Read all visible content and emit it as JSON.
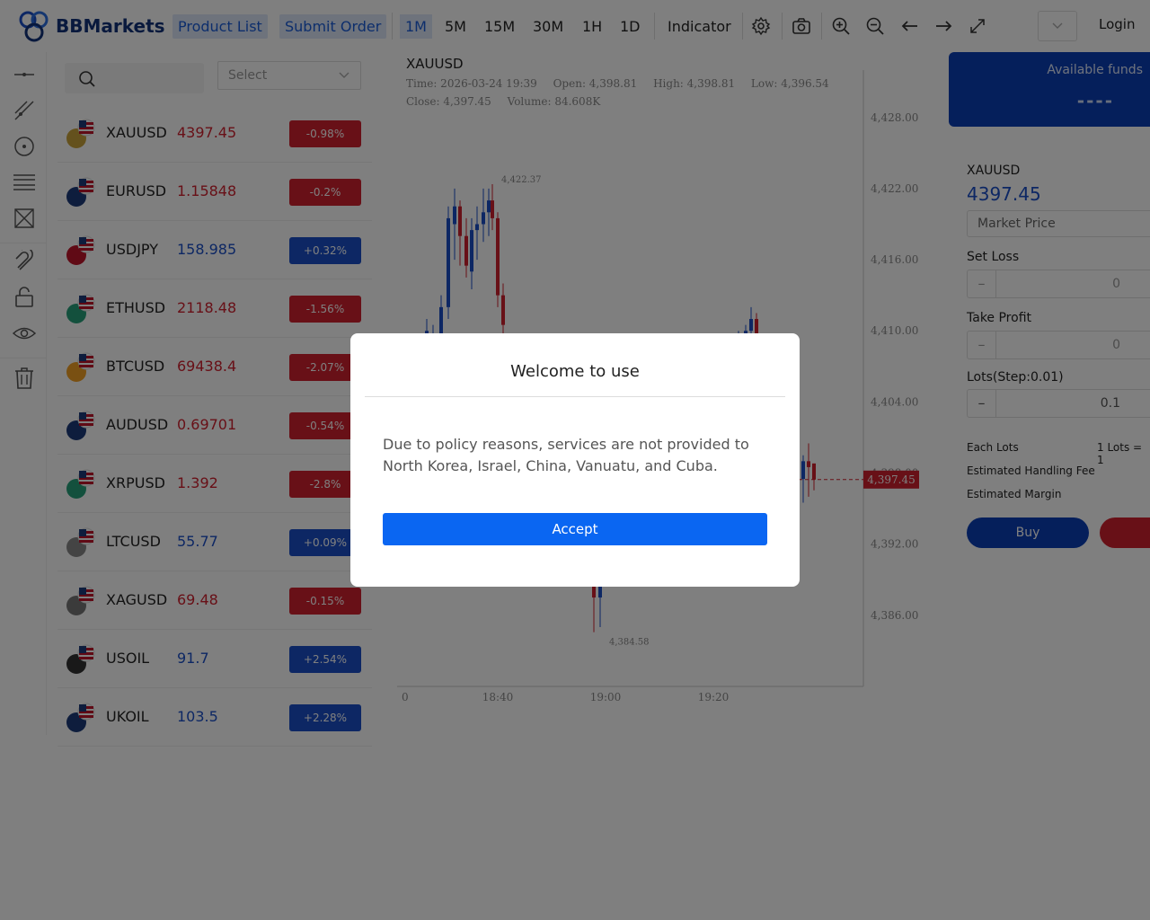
{
  "brand": {
    "name": "BBMarkets",
    "primary": "#0a3eb7",
    "accent": "#1a5dd9"
  },
  "header": {
    "nav": [
      "Product List",
      "Submit Order"
    ],
    "timeframes": [
      "1M",
      "5M",
      "15M",
      "30M",
      "1H",
      "1D"
    ],
    "active_timeframe": "1M",
    "indicator_label": "Indicator",
    "login_label": "Login",
    "tool_icons": [
      "gear-icon",
      "camera-icon",
      "zoom-in-icon",
      "zoom-out-icon",
      "arrow-left-icon",
      "arrow-right-icon",
      "fullscreen-icon"
    ]
  },
  "left_tools": [
    "line-tool-icon",
    "trend-line-icon",
    "circle-tool-icon",
    "fib-tool-icon",
    "pattern-tool-icon",
    "magnet-icon",
    "lock-icon",
    "eye-icon",
    "trash-icon"
  ],
  "product_list": {
    "search_icon": "search-icon",
    "select_placeholder": "Select",
    "items": [
      {
        "symbol": "XAUUSD",
        "price": "4397.45",
        "change": "-0.98%",
        "dir": "neg"
      },
      {
        "symbol": "EURUSD",
        "price": "1.15848",
        "change": "-0.2%",
        "dir": "neg"
      },
      {
        "symbol": "USDJPY",
        "price": "158.985",
        "change": "+0.32%",
        "dir": "pos"
      },
      {
        "symbol": "ETHUSD",
        "price": "2118.48",
        "change": "-1.56%",
        "dir": "neg"
      },
      {
        "symbol": "BTCUSD",
        "price": "69438.4",
        "change": "-2.07%",
        "dir": "neg"
      },
      {
        "symbol": "AUDUSD",
        "price": "0.69701",
        "change": "-0.54%",
        "dir": "neg"
      },
      {
        "symbol": "XRPUSD",
        "price": "1.392",
        "change": "-2.8%",
        "dir": "neg"
      },
      {
        "symbol": "LTCUSD",
        "price": "55.77",
        "change": "+0.09%",
        "dir": "pos"
      },
      {
        "symbol": "XAGUSD",
        "price": "69.48",
        "change": "-0.15%",
        "dir": "neg"
      },
      {
        "symbol": "USOIL",
        "price": "91.7",
        "change": "+2.54%",
        "dir": "pos"
      },
      {
        "symbol": "UKOIL",
        "price": "103.5",
        "change": "+2.28%",
        "dir": "pos"
      }
    ]
  },
  "chart": {
    "symbol": "XAUUSD",
    "info": {
      "time": "Time: 2026-03-24 19:39",
      "open": "Open: 4,398.81",
      "high": "High: 4,398.81",
      "low": "Low: 4,396.54",
      "close": "Close: 4,397.45",
      "volume": "Volume: 84.608K"
    },
    "y_ticks": [
      "4,428.00",
      "4,422.00",
      "4,416.00",
      "4,410.00",
      "4,404.00",
      "4,398.00",
      "4,392.00",
      "4,386.00"
    ],
    "x_ticks": [
      "0",
      "18:40",
      "19:00",
      "19:20"
    ],
    "current_price": "4,397.45",
    "high_mark": "4,422.37",
    "low_mark": "4,384.58"
  },
  "chart_data": {
    "type": "candlestick",
    "ylim": [
      4380,
      4432
    ],
    "y_ticks": [
      4428,
      4422,
      4416,
      4410,
      4404,
      4398,
      4392,
      4386
    ],
    "x_ticks": [
      "18:40",
      "19:00",
      "19:20"
    ],
    "current_price": 4397.45,
    "annotations": [
      {
        "label": "4,422.37",
        "value": 4422.37
      },
      {
        "label": "4,384.58",
        "value": 4384.58
      }
    ],
    "candles": [
      {
        "o": 4409.0,
        "h": 4411.0,
        "l": 4406.5,
        "c": 4410.0
      },
      {
        "o": 4408.5,
        "h": 4410.5,
        "l": 4406.0,
        "c": 4409.5
      },
      {
        "o": 4409.5,
        "h": 4413.0,
        "l": 4407.5,
        "c": 4412.0
      },
      {
        "o": 4412.0,
        "h": 4420.5,
        "l": 4411.0,
        "c": 4419.5
      },
      {
        "o": 4419.0,
        "h": 4422.0,
        "l": 4416.0,
        "c": 4420.5
      },
      {
        "o": 4420.5,
        "h": 4421.0,
        "l": 4415.5,
        "c": 4418.0
      },
      {
        "o": 4418.0,
        "h": 4419.5,
        "l": 4414.5,
        "c": 4415.5
      },
      {
        "o": 4415.0,
        "h": 4419.5,
        "l": 4413.5,
        "c": 4418.5
      },
      {
        "o": 4418.5,
        "h": 4420.5,
        "l": 4416.0,
        "c": 4419.0
      },
      {
        "o": 4419.0,
        "h": 4422.0,
        "l": 4417.5,
        "c": 4420.0
      },
      {
        "o": 4420.0,
        "h": 4422.0,
        "l": 4418.0,
        "c": 4421.0
      },
      {
        "o": 4421.0,
        "h": 4422.37,
        "l": 4418.5,
        "c": 4419.5
      },
      {
        "o": 4419.5,
        "h": 4420.0,
        "l": 4412.0,
        "c": 4413.0
      },
      {
        "o": 4413.0,
        "h": 4414.0,
        "l": 4409.5,
        "c": 4410.5
      },
      {
        "o": 4390.5,
        "h": 4391.5,
        "l": 4384.58,
        "c": 4387.5
      },
      {
        "o": 4387.5,
        "h": 4391.0,
        "l": 4385.0,
        "c": 4390.0
      },
      {
        "o": 4409.0,
        "h": 4410.0,
        "l": 4407.0,
        "c": 4409.5
      },
      {
        "o": 4409.5,
        "h": 4410.5,
        "l": 4408.0,
        "c": 4410.0
      },
      {
        "o": 4410.0,
        "h": 4412.0,
        "l": 4408.5,
        "c": 4411.0
      },
      {
        "o": 4411.0,
        "h": 4411.5,
        "l": 4407.5,
        "c": 4408.0
      },
      {
        "o": 4397.5,
        "h": 4399.5,
        "l": 4395.5,
        "c": 4399.0
      },
      {
        "o": 4399.0,
        "h": 4400.5,
        "l": 4396.0,
        "c": 4398.5
      },
      {
        "o": 4398.81,
        "h": 4398.81,
        "l": 4396.54,
        "c": 4397.45
      }
    ]
  },
  "order": {
    "available_funds_label": "Available funds",
    "available_funds_value": "----",
    "symbol": "XAUUSD",
    "price": "4397.45",
    "order_type": "Market Price",
    "set_loss_label": "Set Loss",
    "set_loss_value": "0",
    "take_profit_label": "Take Profit",
    "take_profit_value": "0",
    "lots_label": "Lots(Step:0.01)",
    "lots_value": "0.1",
    "minus_symbol": "–",
    "each_lots_label": "Each Lots",
    "each_lots_value": "1 Lots = 1",
    "handling_fee_label": "Estimated Handling Fee",
    "margin_label": "Estimated Margin",
    "buy_label": "Buy"
  },
  "modal": {
    "title": "Welcome to use",
    "body": "Due to policy reasons, services are not provided to North Korea, Israel, China, Vanuatu, and Cuba.",
    "accept_label": "Accept"
  }
}
